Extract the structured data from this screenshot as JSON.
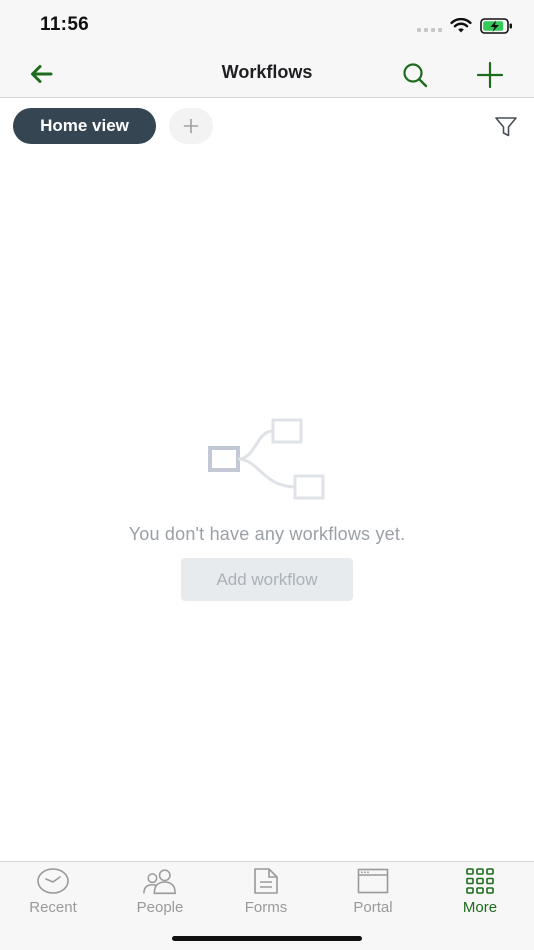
{
  "status_bar": {
    "time": "11:56"
  },
  "nav": {
    "title": "Workflows",
    "back_icon": "arrow-left-icon",
    "search_icon": "search-icon",
    "add_icon": "plus-icon"
  },
  "views": {
    "active_view": "Home view",
    "add_view_icon": "plus-icon",
    "filter_icon": "filter-icon"
  },
  "empty_state": {
    "illustration_icon": "workflow-tree-icon",
    "message": "You don't have any workflows yet.",
    "button_label": "Add workflow"
  },
  "tab_bar": {
    "tabs": [
      {
        "label": "Recent",
        "icon": "clock-icon",
        "active": false
      },
      {
        "label": "People",
        "icon": "people-icon",
        "active": false
      },
      {
        "label": "Forms",
        "icon": "document-icon",
        "active": false
      },
      {
        "label": "Portal",
        "icon": "browser-window-icon",
        "active": false
      },
      {
        "label": "More",
        "icon": "grid-icon",
        "active": true
      }
    ]
  },
  "colors": {
    "accent_green": "#1d6b1d",
    "chip_active_bg": "#354652",
    "muted_text": "#9aa0a6",
    "disabled_button_bg": "#e8ebee"
  }
}
